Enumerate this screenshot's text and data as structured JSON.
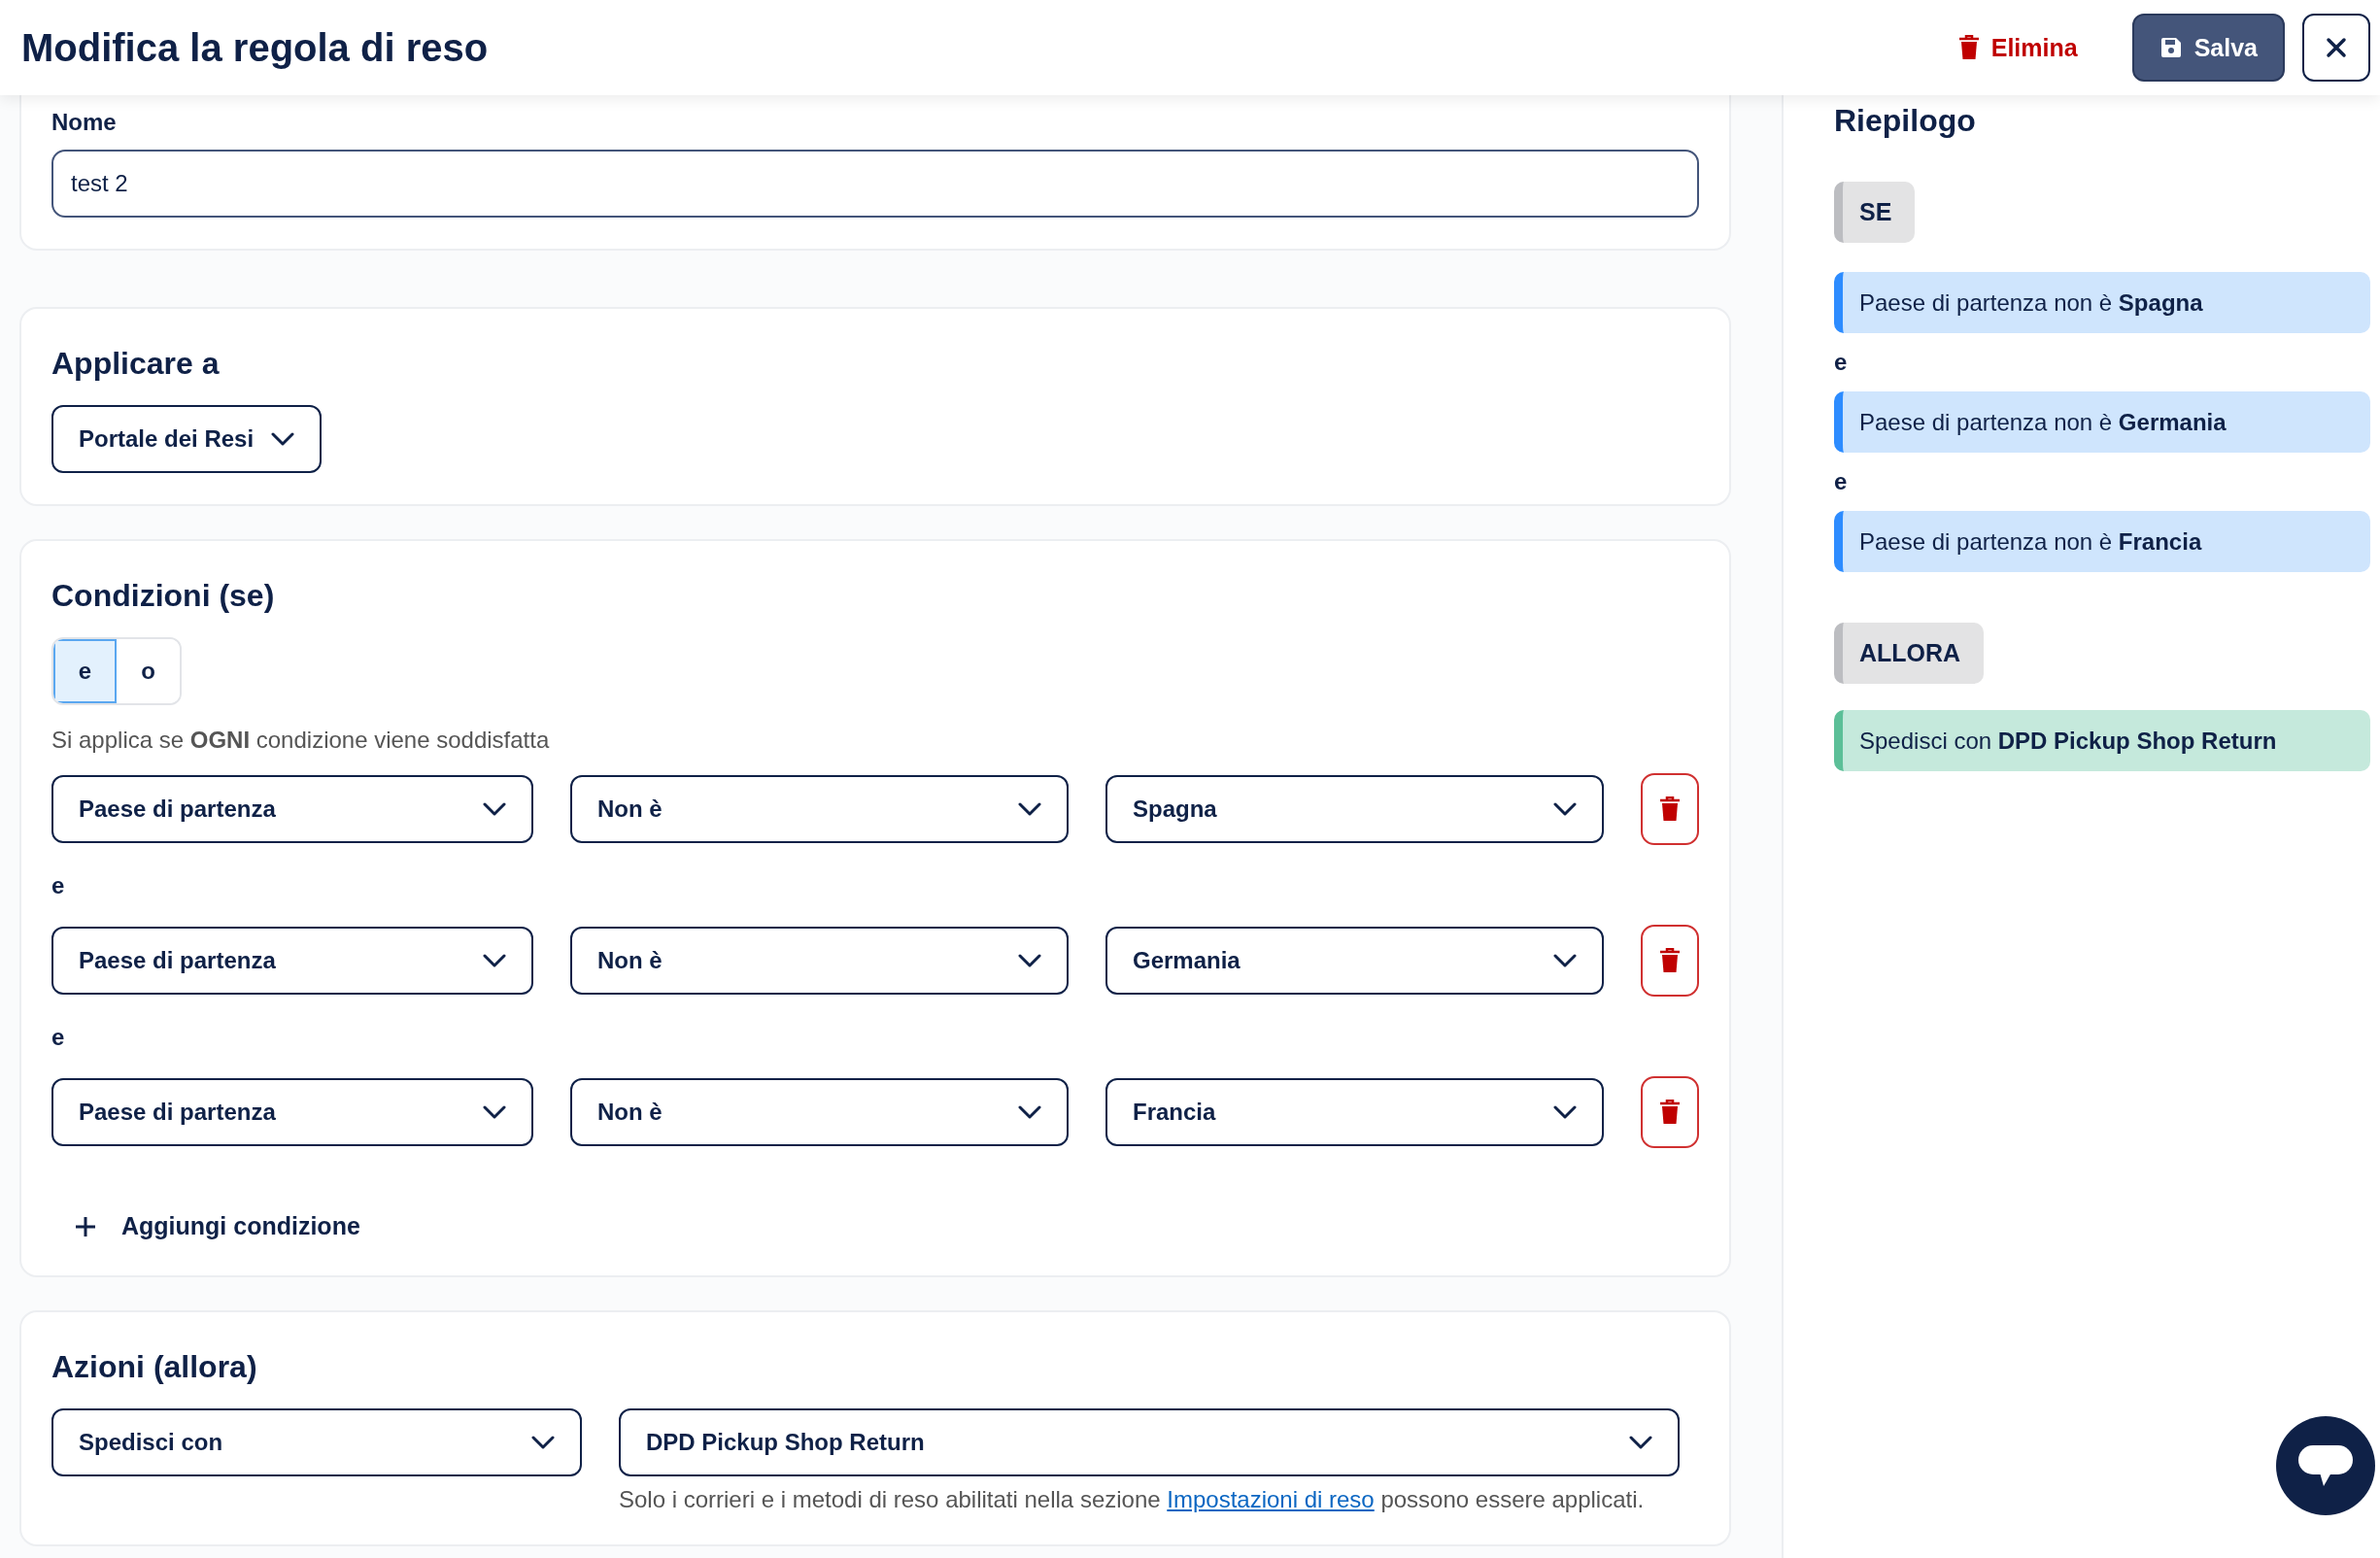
{
  "header": {
    "title": "Modifica la regola di reso",
    "delete_button": "Elimina",
    "save_button": "Salva"
  },
  "name_field": {
    "label": "Nome",
    "value": "test 2"
  },
  "apply_to": {
    "title": "Applicare a",
    "dropdown": "Portale dei Resi"
  },
  "conditions": {
    "title": "Condizioni (se)",
    "operators": [
      {
        "label": "e",
        "selected": true
      },
      {
        "label": "o",
        "selected": false
      }
    ],
    "hint": "Si applica se **OGNI** condizione viene soddisfatta",
    "rows": [
      {
        "field": "Paese di partenza",
        "operator": "Non è",
        "value": "Spagna"
      },
      {
        "joiner": "e",
        "field": "Paese di partenza",
        "operator": "Non è",
        "value": "Germania"
      },
      {
        "joiner": "e",
        "field": "Paese di partenza",
        "operator": "Non è",
        "value": "Francia"
      }
    ],
    "add_button": "Aggiungi condizione"
  },
  "actions": {
    "title": "Azioni (allora)",
    "action": "Spedisci con",
    "carrier": "DPD Pickup Shop Return",
    "note_before": "Solo i corrieri e i metodi di reso abilitati nella sezione",
    "note_link": "Impostazioni di reso",
    "note_after": "possono essere applicati."
  },
  "summary": {
    "title": "Riepilogo",
    "if_label": "SE",
    "conditions": [
      {
        "text": "Paese di partenza non è **Spagna**"
      },
      {
        "joiner": "e",
        "text": "Paese di partenza non è **Germania**"
      },
      {
        "joiner": "e",
        "text": "Paese di partenza non è **Francia**"
      }
    ],
    "then_label": "ALLORA",
    "actions": [
      "Spedisci con **DPD Pickup Shop Return**"
    ]
  }
}
